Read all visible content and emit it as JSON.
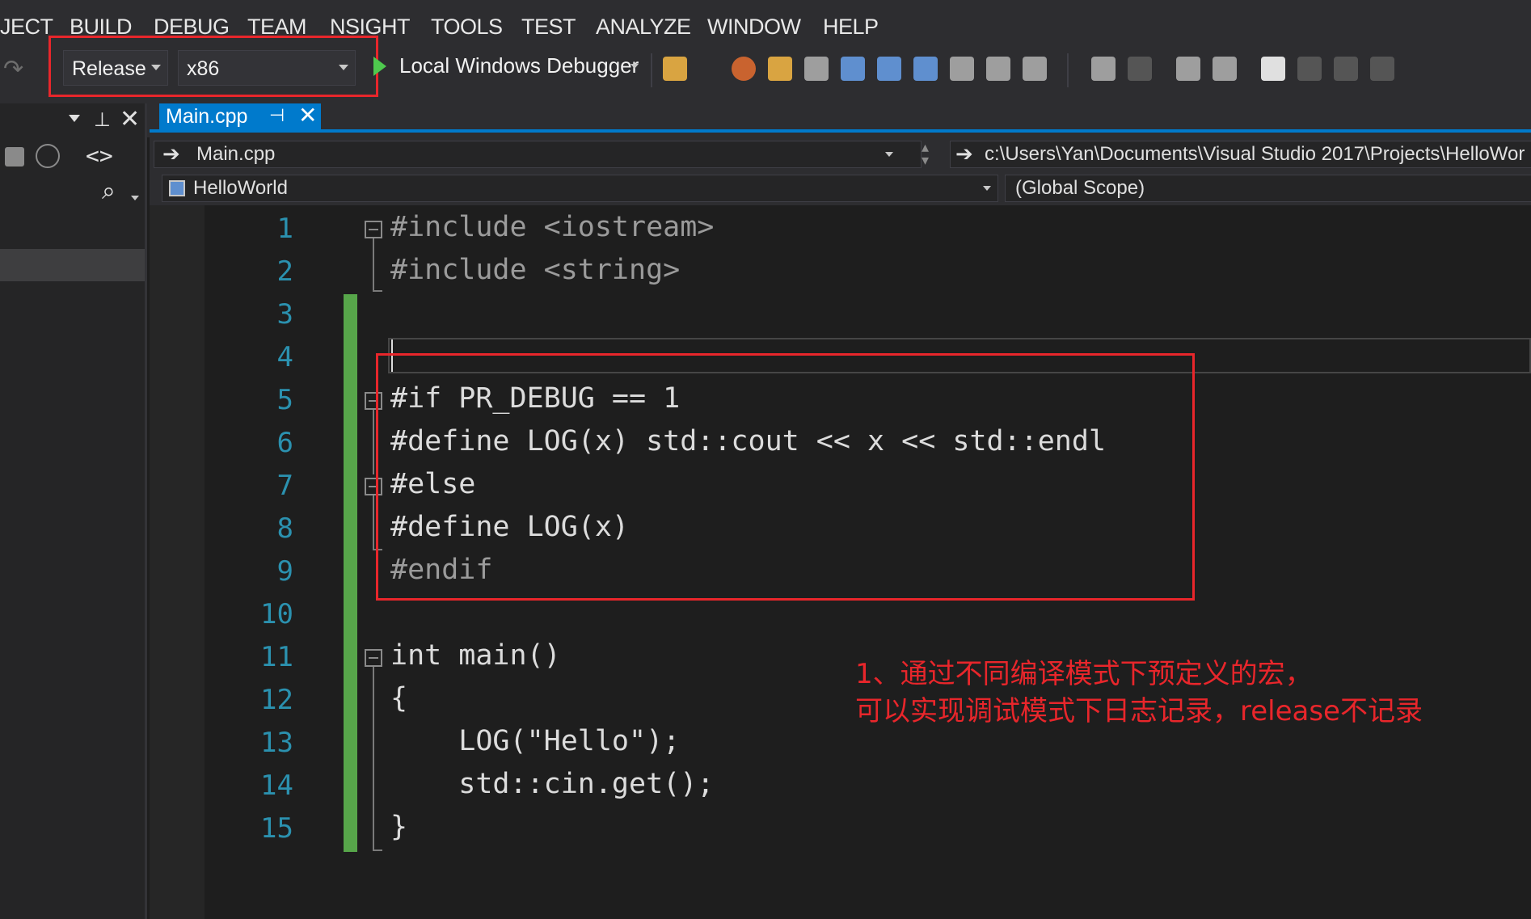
{
  "menu": [
    "JECT",
    "BUILD",
    "DEBUG",
    "TEAM",
    "NSIGHT",
    "TOOLS",
    "TEST",
    "ANALYZE",
    "WINDOW",
    "HELP"
  ],
  "toolbar": {
    "config": "Release",
    "platform": "x86",
    "debugger": "Local Windows Debugger"
  },
  "tabs": [
    {
      "label": "Main.cpp",
      "active": true
    }
  ],
  "navbar": {
    "file": "Main.cpp",
    "path": "c:\\Users\\Yan\\Documents\\Visual Studio 2017\\Projects\\HelloWor",
    "project": "HelloWorld",
    "scope": "(Global Scope)"
  },
  "editor": {
    "line_numbers": [
      "1",
      "2",
      "3",
      "4",
      "5",
      "6",
      "7",
      "8",
      "9",
      "10",
      "11",
      "12",
      "13",
      "14",
      "15"
    ],
    "lines": [
      "#include <iostream>",
      "#include <string>",
      "",
      "",
      "#if PR_DEBUG == 1",
      "#define LOG(x) std::cout << x << std::endl",
      "#else",
      "#define LOG(x)",
      "#endif",
      "",
      "int main()",
      "{",
      "    LOG(\"Hello\");",
      "    std::cin.get();",
      "}"
    ]
  },
  "annotation": {
    "line1": "1、通过不同编译模式下预定义的宏，",
    "line2": "可以实现调试模式下日志记录，release不记录"
  },
  "colors": {
    "accent": "#007acc",
    "highlight_box": "#e8262b",
    "line_number": "#2b91af",
    "change_bar": "#57a64a"
  }
}
